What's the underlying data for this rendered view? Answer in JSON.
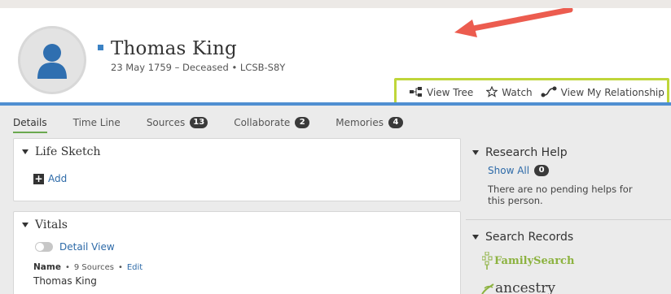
{
  "person": {
    "name": "Thomas King",
    "meta": "23 May 1759 – Deceased • LCSB-S8Y"
  },
  "actions": {
    "view_tree": "View Tree",
    "watch": "Watch",
    "view_relationship": "View My Relationship"
  },
  "tabs": [
    {
      "label": "Details"
    },
    {
      "label": "Time Line"
    },
    {
      "label": "Sources",
      "badge": "13"
    },
    {
      "label": "Collaborate",
      "badge": "2"
    },
    {
      "label": "Memories",
      "badge": "4"
    }
  ],
  "life_sketch": {
    "title": "Life Sketch",
    "add_label": "Add"
  },
  "vitals": {
    "title": "Vitals",
    "detail_view_label": "Detail View",
    "name_label": "Name",
    "name_sources": "9 Sources",
    "edit_label": "Edit",
    "name_value": "Thomas King"
  },
  "research_help": {
    "title": "Research Help",
    "show_all": "Show All",
    "count": "0",
    "message": "There are no pending helps for this person."
  },
  "search_records": {
    "title": "Search Records",
    "familysearch": "FamilySearch",
    "ancestry": "ancestry"
  },
  "colors": {
    "highlight_border": "#bfd63a",
    "arrow": "#ec5c4f",
    "accent_blue": "#4f8fd1",
    "link": "#2d6aa8"
  }
}
